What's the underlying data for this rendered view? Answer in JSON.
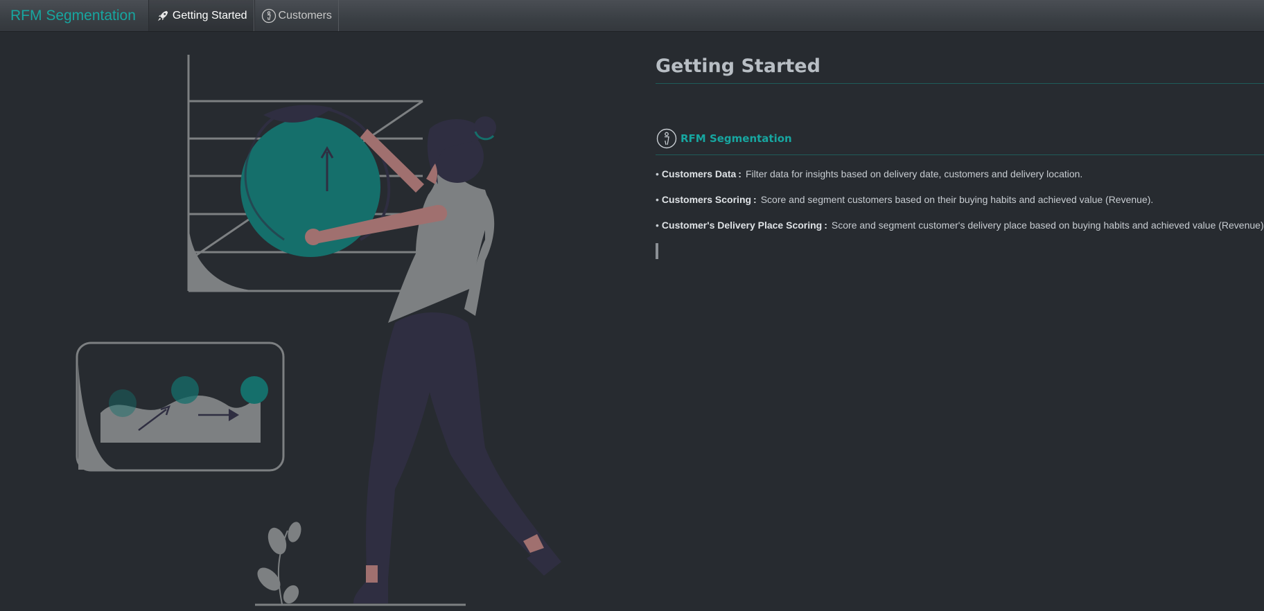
{
  "navbar": {
    "brand": "RFM Segmentation",
    "tabs": [
      {
        "label": "Getting Started",
        "icon": "rocket-icon",
        "active": true
      },
      {
        "label": "Customers",
        "icon": "person-circle-icon",
        "active": false
      }
    ]
  },
  "main": {
    "title": "Getting Started",
    "section": {
      "icon": "person-circle-icon",
      "title": "RFM Segmentation"
    },
    "features": [
      {
        "label": "Customers Data",
        "separator": ":",
        "text": "Filter data for insights based on delivery date, customers and delivery location."
      },
      {
        "label": "Customers Scoring",
        "separator": ":",
        "text": "Score and segment customers based on their buying habits and achieved value (Revenue)."
      },
      {
        "label": "Customer's Delivery Place Scoring",
        "separator": ":",
        "text": "Score and segment customer's delivery place based on buying habits and achieved value (Revenue)."
      }
    ]
  },
  "colors": {
    "background": "#272b30",
    "accent": "#17a6a0",
    "illustration_teal": "#156f6b",
    "illustration_gray": "#7d8082",
    "illustration_dark": "#2f2e41",
    "skin": "#a0706f"
  }
}
